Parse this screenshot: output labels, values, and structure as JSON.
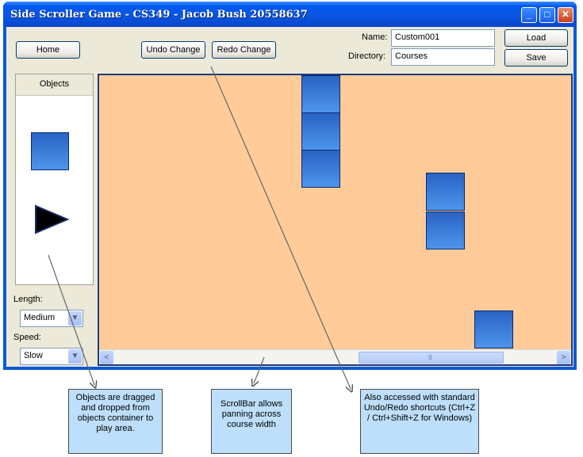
{
  "window": {
    "title": "Side Scroller Game - CS349 - Jacob Bush 20558637",
    "controls": {
      "minimize": "_",
      "maximize": "□",
      "close": "✕"
    }
  },
  "toolbar": {
    "home_label": "Home",
    "undo_label": "Undo Change",
    "redo_label": "Redo Change",
    "name_label": "Name:",
    "name_value": "Custom001",
    "directory_label": "Directory:",
    "directory_value": "Courses",
    "load_label": "Load",
    "save_label": "Save"
  },
  "objects_panel": {
    "title": "Objects",
    "items": [
      {
        "icon": "block-icon"
      },
      {
        "icon": "play-arrow-icon"
      }
    ]
  },
  "settings": {
    "length_label": "Length:",
    "length_value": "Medium",
    "speed_label": "Speed:",
    "speed_value": "Slow"
  },
  "play_area": {
    "background_color": "#ffcc99",
    "block_color": "#3a7ad8",
    "blocks_count": 6
  },
  "scrollbar": {
    "left_arrow": "<",
    "right_arrow": ">",
    "thumb_grip": "|||||"
  },
  "annotations": {
    "objects": "Objects are dragged and dropped from objects container to play area.",
    "scrollbar": "ScrollBar allows panning across course width",
    "undo": "Also accessed with standard Undo/Redo shortcuts (Ctrl+Z / Ctrl+Shift+Z for Windows)"
  }
}
